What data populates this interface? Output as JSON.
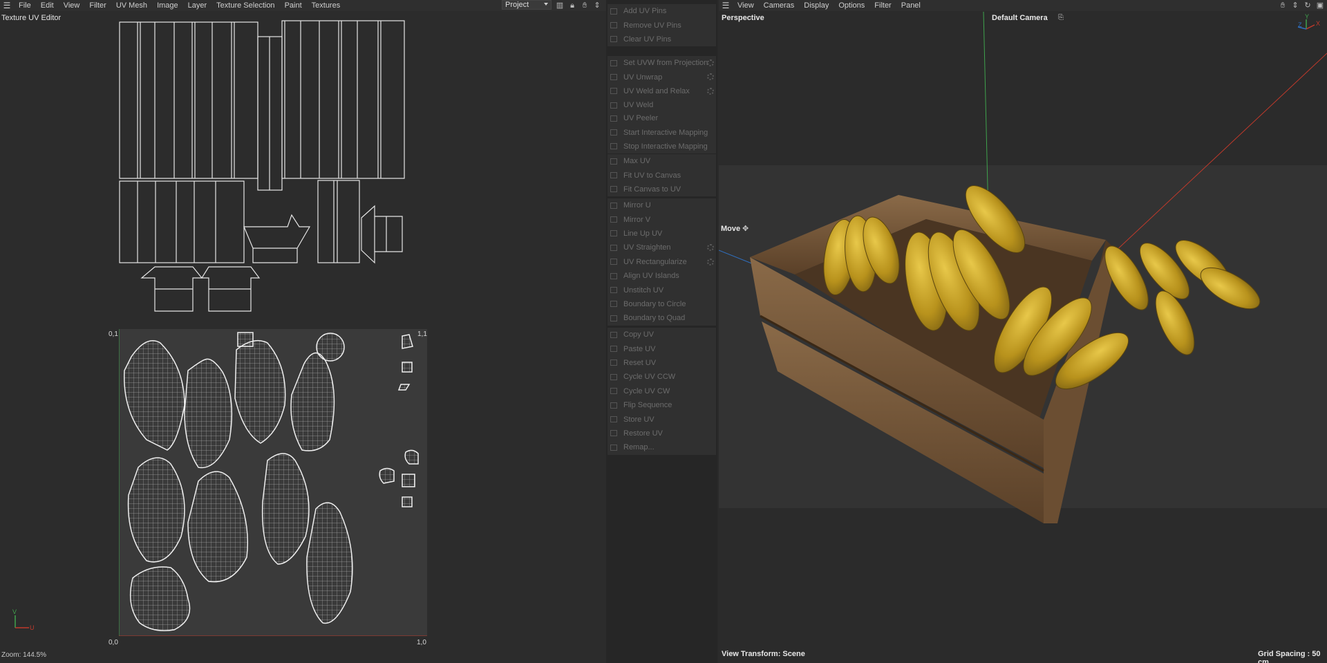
{
  "uv_editor": {
    "menu": [
      "File",
      "Edit",
      "View",
      "Filter",
      "UV Mesh",
      "Image",
      "Layer",
      "Texture Selection",
      "Paint",
      "Textures"
    ],
    "title": "Texture UV Editor",
    "project_select": "Project",
    "corner_labels": {
      "top_left": "0,1",
      "top_right": "1,1",
      "bottom_left": "0,0",
      "bottom_right": "1,0"
    },
    "axis_labels": {
      "v": "V",
      "u": "U"
    },
    "zoom": "Zoom: 144.5%"
  },
  "commands": {
    "groups": [
      [
        "Add UV Pins",
        "Remove UV Pins",
        "Clear UV Pins"
      ],
      [
        "Set UVW from Projection",
        "UV Unwrap",
        "UV Weld and Relax",
        "UV Weld"
      ],
      [
        "UV Peeler",
        "Start Interactive Mapping",
        "Stop Interactive Mapping"
      ],
      [
        "Max UV",
        "Fit UV to Canvas",
        "Fit Canvas to UV"
      ],
      [
        "Mirror U",
        "Mirror V",
        "Line Up UV",
        "UV Straighten",
        "UV Rectangularize",
        "Align UV Islands",
        "Unstitch UV",
        "Boundary to Circle",
        "Boundary to Quad"
      ],
      [
        "Copy UV",
        "Paste UV",
        "Reset UV",
        "Cycle UV CCW",
        "Cycle UV CW",
        "Flip Sequence",
        "Store UV",
        "Restore UV",
        "Remap..."
      ]
    ],
    "with_settings": [
      "Set UVW from Projection",
      "UV Unwrap",
      "UV Weld and Relax",
      "UV Straighten",
      "UV Rectangularize"
    ]
  },
  "viewport": {
    "menu": [
      "View",
      "Cameras",
      "Display",
      "Options",
      "Filter",
      "Panel"
    ],
    "view_name": "Perspective",
    "camera": "Default Camera",
    "tool": "Move",
    "view_transform": "View Transform: Scene",
    "grid_spacing": "Grid Spacing : 50 cm",
    "axis_labels": {
      "z": "Z",
      "y": "Y",
      "x": "X"
    }
  },
  "colors": {
    "accent_green": "#3fa34d",
    "accent_red": "#c0392b",
    "crate": "#7a5a3a",
    "banana": "#c9a825"
  }
}
